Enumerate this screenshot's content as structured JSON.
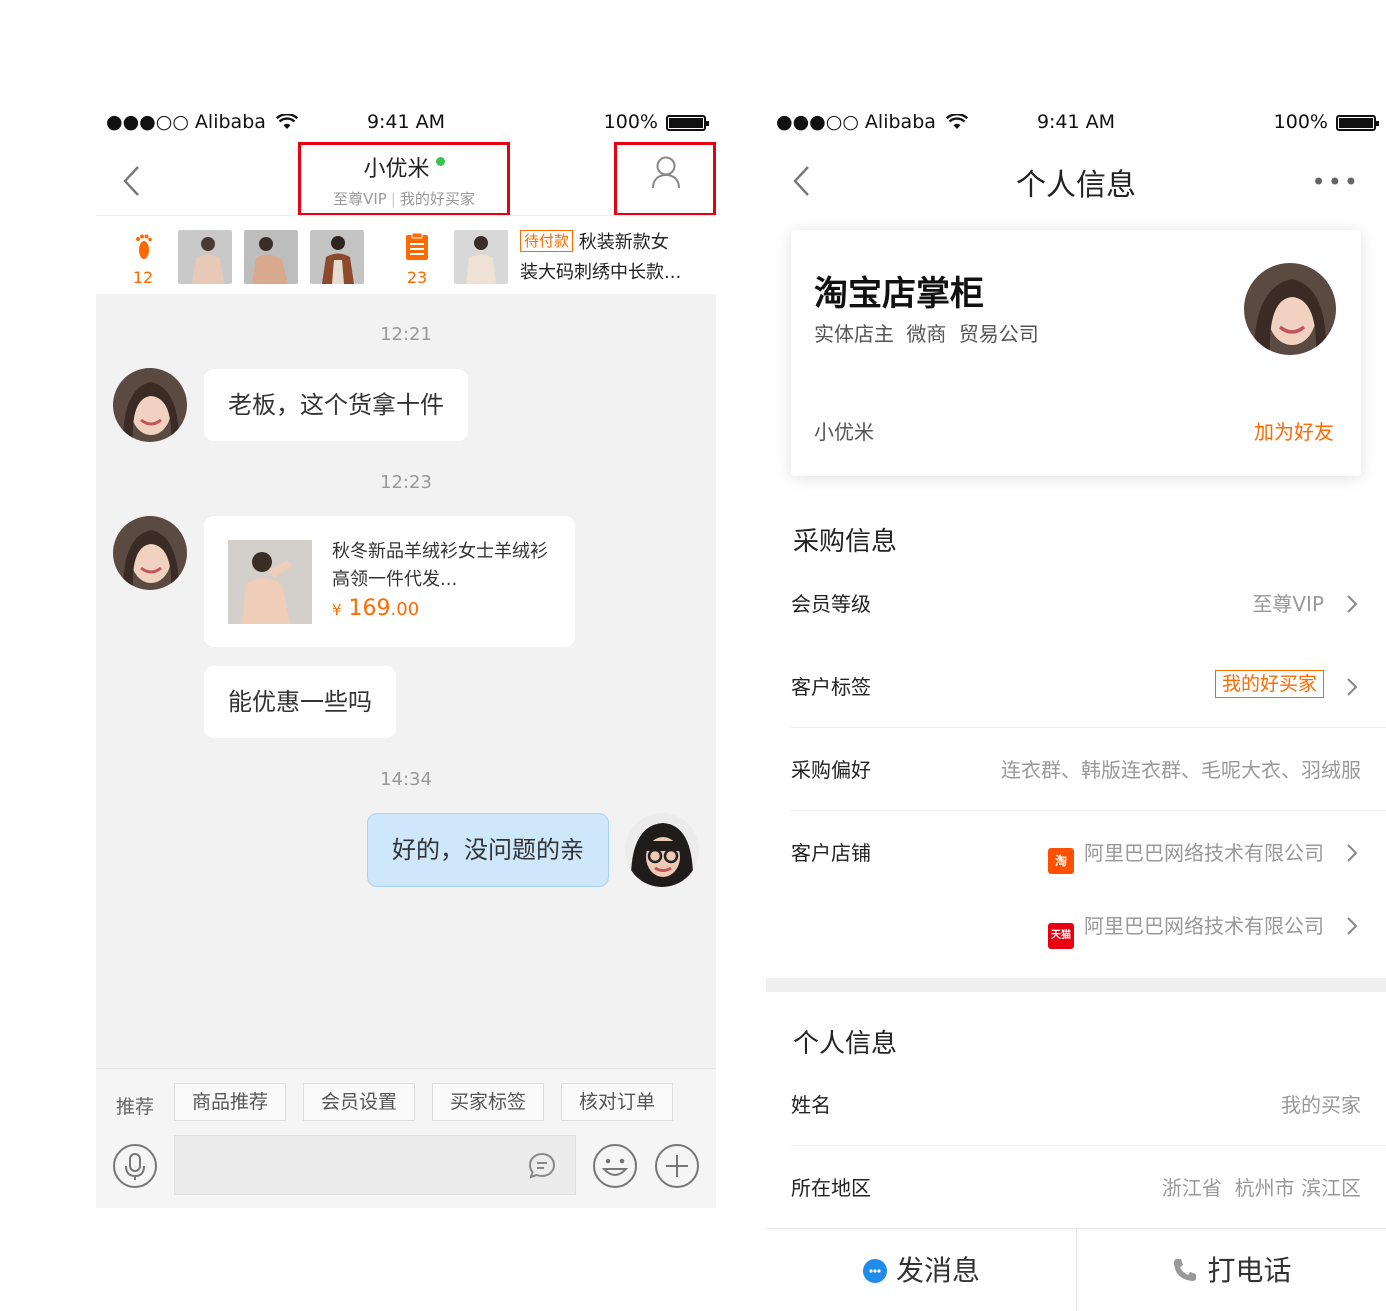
{
  "status_bar": {
    "carrier": "●●●○○ Alibaba",
    "time": "9:41 AM",
    "battery": "100%"
  },
  "chat": {
    "title": "小优米",
    "subtitle_level": "至尊VIP",
    "subtitle_sep": "|",
    "subtitle_tag": "我的好买家",
    "footprint_count": "12",
    "order_count": "23",
    "order_status": "待付款",
    "order_title_line1": "秋装新款女",
    "order_title_line2": "装大码刺绣中长款...",
    "messages": [
      {
        "time": "12:21",
        "text": "老板，这个货拿十件"
      },
      {
        "time": "12:23"
      },
      {
        "text": "能优惠一些吗"
      },
      {
        "time": "14:34",
        "text": "好的，没问题的亲"
      }
    ],
    "product": {
      "title": "秋冬新品羊绒衫女士羊绒衫高领一件代发...",
      "price_symbol": "¥",
      "price_int": "169",
      "price_dec": ".00"
    },
    "quick_label": "推荐",
    "quick_buttons": [
      "商品推荐",
      "会员设置",
      "买家标签",
      "核对订单"
    ]
  },
  "profile": {
    "title": "个人信息",
    "more": "•••",
    "name": "淘宝店掌柜",
    "tags": "实体店主 微商 贸易公司",
    "nickname": "小优米",
    "add_friend": "加为好友",
    "purchase_section": "采购信息",
    "rows": {
      "member_level": {
        "label": "会员等级",
        "value": "至尊VIP"
      },
      "customer_tag": {
        "label": "客户标签",
        "value": "我的好买家"
      },
      "preference": {
        "label": "采购偏好",
        "value": "连衣群、韩版连衣群、毛呢大衣、羽绒服"
      },
      "shop": {
        "label": "客户店铺",
        "value1": "阿里巴巴网络技术有限公司",
        "value2": "阿里巴巴网络技术有限公司",
        "icon1": "淘",
        "icon2": "天猫"
      }
    },
    "personal_section": "个人信息",
    "name_row": {
      "label": "姓名",
      "value": "我的买家"
    },
    "region_row": {
      "label": "所在地区",
      "value": "浙江省  杭州市 滨江区"
    },
    "actions": {
      "message": "发消息",
      "call": "打电话"
    }
  },
  "colors": {
    "accent": "#ff6a00",
    "highlight": "#e60012",
    "mine_bubble": "#cfe7fb",
    "online": "#3cc14d"
  }
}
